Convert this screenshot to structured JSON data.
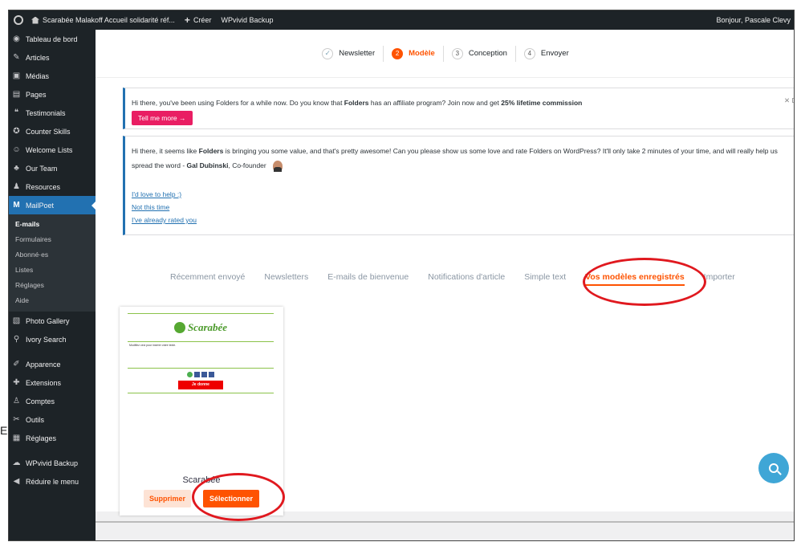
{
  "adminbar": {
    "site": "Scarabée Malakoff Accueil solidarité réf...",
    "new_label": "Créer",
    "plugin": "WPvivid Backup",
    "greeting": "Bonjour, Pascale Clevy"
  },
  "sidebar": {
    "items": [
      {
        "label": "Tableau de bord",
        "icon": "dashboard-icon",
        "glyph": "◉"
      },
      {
        "label": "Articles",
        "icon": "pin-icon",
        "glyph": "✎"
      },
      {
        "label": "Médias",
        "icon": "media-icon",
        "glyph": "▣"
      },
      {
        "label": "Pages",
        "icon": "page-icon",
        "glyph": "▤"
      },
      {
        "label": "Testimonials",
        "icon": "quote-icon",
        "glyph": "❝"
      },
      {
        "label": "Counter Skills",
        "icon": "counter-icon",
        "glyph": "✪"
      },
      {
        "label": "Welcome Lists",
        "icon": "list-icon",
        "glyph": "☺"
      },
      {
        "label": "Our Team",
        "icon": "team-icon",
        "glyph": "♣"
      },
      {
        "label": "Resources",
        "icon": "resources-icon",
        "glyph": "♟"
      },
      {
        "label": "MailPoet",
        "icon": "mailpoet-icon",
        "glyph": "M"
      }
    ],
    "submenu": [
      "E-mails",
      "Formulaires",
      "Abonné·es",
      "Listes",
      "Réglages",
      "Aide"
    ],
    "items2": [
      {
        "label": "Photo Gallery",
        "icon": "gallery-icon",
        "glyph": "▧"
      },
      {
        "label": "Ivory Search",
        "icon": "search-icon",
        "glyph": "⚲"
      },
      {
        "label": "Apparence",
        "icon": "brush-icon",
        "glyph": "✐"
      },
      {
        "label": "Extensions",
        "icon": "plugin-icon",
        "glyph": "✚"
      },
      {
        "label": "Comptes",
        "icon": "user-icon",
        "glyph": "♙"
      },
      {
        "label": "Outils",
        "icon": "wrench-icon",
        "glyph": "✂"
      },
      {
        "label": "Réglages",
        "icon": "settings-icon",
        "glyph": "▦"
      },
      {
        "label": "WPvivid Backup",
        "icon": "cloud-icon",
        "glyph": "☁"
      },
      {
        "label": "Réduire le menu",
        "icon": "collapse-icon",
        "glyph": "◀"
      }
    ]
  },
  "steps": [
    {
      "num": "✓",
      "label": "Newsletter"
    },
    {
      "num": "2",
      "label": "Modèle"
    },
    {
      "num": "3",
      "label": "Conception"
    },
    {
      "num": "4",
      "label": "Envoyer"
    }
  ],
  "notice1": {
    "text_a": "Hi there, you've been using Folders for a while now. Do you know that ",
    "bold_a": "Folders",
    "text_b": " has an affiliate program? Join now and get ",
    "bold_b": "25% lifetime commission",
    "button": "Tell me more →",
    "dismiss": "✕ Dismis"
  },
  "notice2": {
    "text_a": "Hi there, it seems like ",
    "bold_a": "Folders",
    "text_b": " is bringing you some value, and that's pretty awesome! Can you please show us some love and rate Folders on WordPress? It'll only take 2 minutes of your time, and will really help us spread the word - ",
    "bold_b": "Gal Dubinski",
    "text_c": ", Co-founder",
    "links": [
      "I'd love to help :)",
      "Not this time",
      "I've already rated you"
    ],
    "close": "✕"
  },
  "tabs": [
    "Récemment envoyé",
    "Newsletters",
    "E-mails de bienvenue",
    "Notifications d'article",
    "Simple text",
    "Vos modèles enregistrés",
    "Importer"
  ],
  "template": {
    "title": "Scarabée",
    "logo_text": "Scarabée",
    "tagline": "Modifiez ceci pour insérer votre texte.",
    "donate": "Je donne",
    "delete": "Supprimer",
    "select": "Sélectionner"
  },
  "colors": {
    "accent": "#fe5301",
    "annotation": "#e0191f",
    "wp_blue": "#2271b1"
  }
}
